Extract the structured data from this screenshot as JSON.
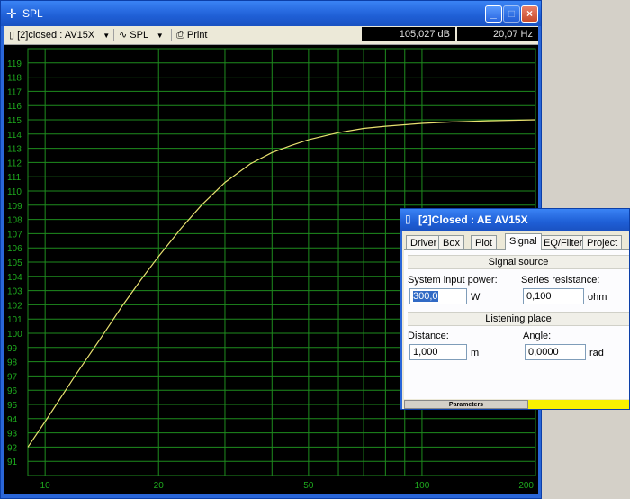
{
  "window": {
    "title": "SPL",
    "title_icon": "crosshair-icon",
    "min_label": "_",
    "max_label": "□",
    "close_label": "×"
  },
  "toolbar": {
    "driver_label": "[2]closed : AV15X",
    "plot_label": "SPL",
    "print_label": "Print",
    "readout_db": "105,027 dB",
    "readout_hz": "20,07 Hz"
  },
  "params": {
    "title": "[2]Closed : AE AV15X",
    "tabs": [
      "Driver",
      "Box",
      "Plot",
      "Signal",
      "EQ/Filter",
      "Project"
    ],
    "active_tab": "Signal",
    "signal_source_header": "Signal source",
    "system_input_power_label": "System input power:",
    "system_input_power_value": "300,0",
    "system_input_power_unit": "W",
    "series_resistance_label": "Series resistance:",
    "series_resistance_value": "0,100",
    "series_resistance_unit": "ohm",
    "listening_place_header": "Listening place",
    "distance_label": "Distance:",
    "distance_value": "1,000",
    "distance_unit": "m",
    "angle_label": "Angle:",
    "angle_value": "0,0000",
    "angle_unit": "rad",
    "status_label": "Parameters"
  },
  "chart_data": {
    "type": "line",
    "xscale": "log",
    "xlim": [
      9,
      200
    ],
    "ylim": [
      90,
      120
    ],
    "y_ticks": [
      91,
      92,
      93,
      94,
      95,
      96,
      97,
      98,
      99,
      100,
      101,
      102,
      103,
      104,
      105,
      106,
      107,
      108,
      109,
      110,
      111,
      112,
      113,
      114,
      115,
      116,
      117,
      118,
      119
    ],
    "x_tick_labels": [
      "10",
      "20",
      "50",
      "100",
      "200"
    ],
    "x_tick_values": [
      10,
      20,
      50,
      100,
      200
    ],
    "x_grid": [
      10,
      20,
      30,
      40,
      50,
      60,
      70,
      80,
      90,
      100,
      200
    ],
    "grid": true,
    "background": "#000000",
    "grid_color": "#1e8c1e",
    "text_color": "#1eaa1e",
    "line_color": "#e8e070",
    "series": [
      {
        "x": [
          9,
          10,
          12,
          14,
          16,
          18,
          20,
          23,
          26,
          30,
          35,
          40,
          45,
          50,
          60,
          70,
          80,
          100,
          120,
          150,
          200
        ],
        "y": [
          92.0,
          93.8,
          97.0,
          99.6,
          101.9,
          103.8,
          105.4,
          107.4,
          109.0,
          110.6,
          111.9,
          112.7,
          113.2,
          113.6,
          114.1,
          114.4,
          114.55,
          114.75,
          114.85,
          114.93,
          115.0
        ]
      }
    ]
  }
}
